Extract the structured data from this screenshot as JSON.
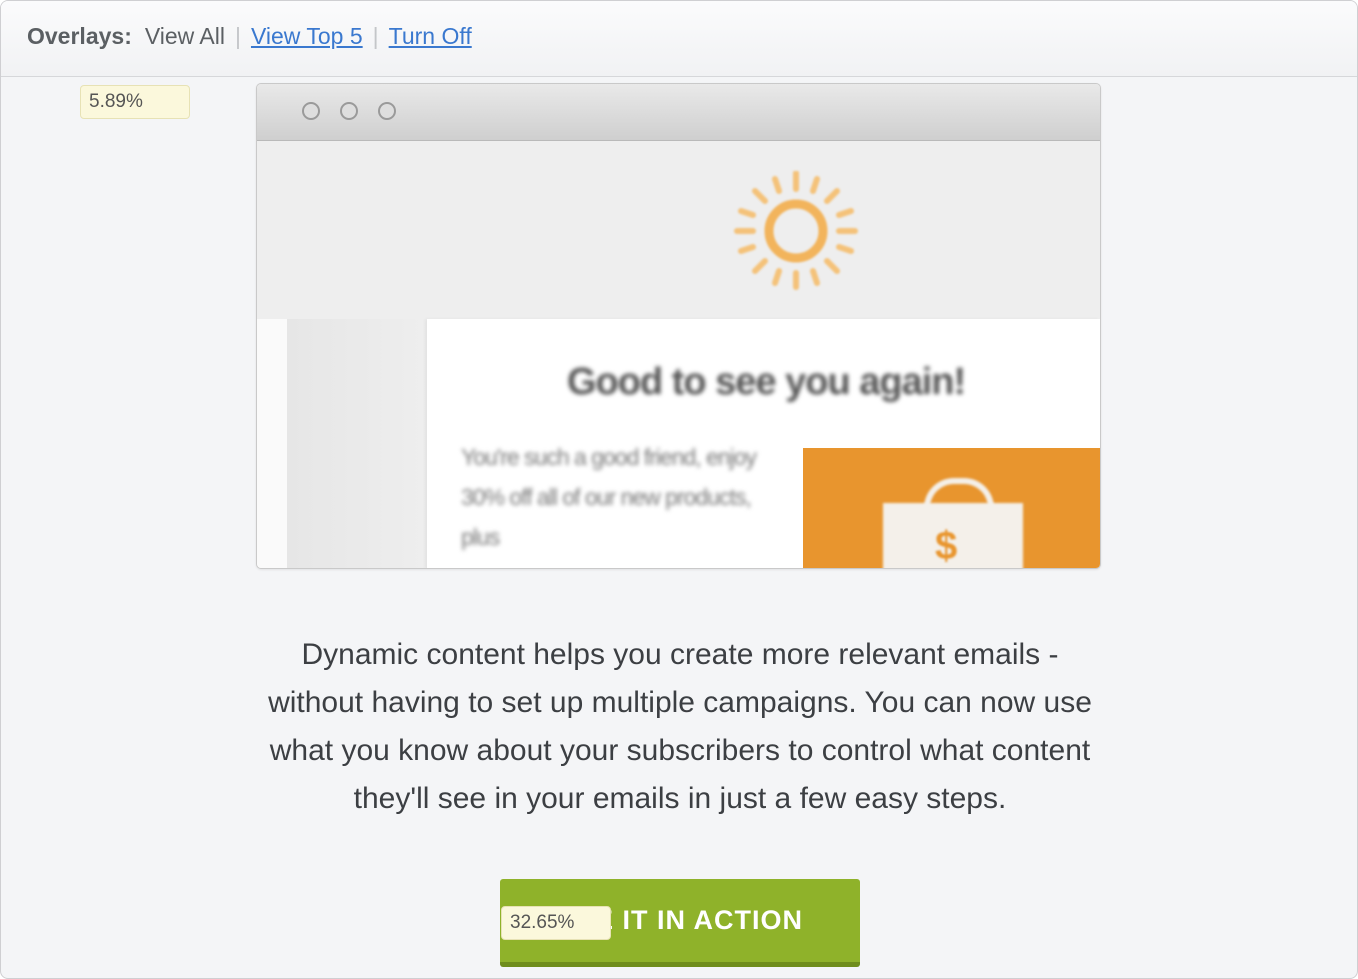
{
  "overlay_bar": {
    "label": "Overlays:",
    "current": "View All",
    "separator": "|",
    "view_top5": "View Top 5",
    "turn_off": "Turn Off"
  },
  "badges": {
    "top_pct": "5.89%",
    "cta_pct": "32.65%"
  },
  "mockup": {
    "heading": "Good to see you again!",
    "body": "You're such a good friend, enjoy 30% off all of our new products, plus",
    "promo_symbol": "$"
  },
  "description": "Dynamic content helps you create more relevant emails - without having to set up multiple campaigns. You can now use what you know about your subscribers to control what content they'll see in your emails in just a few easy steps.",
  "cta": {
    "label": "SEE IT IN ACTION"
  },
  "colors": {
    "cta": "#8fb22a",
    "promo": "#e8952e",
    "link": "#3a78cf",
    "badge": "#fbf8dc"
  }
}
